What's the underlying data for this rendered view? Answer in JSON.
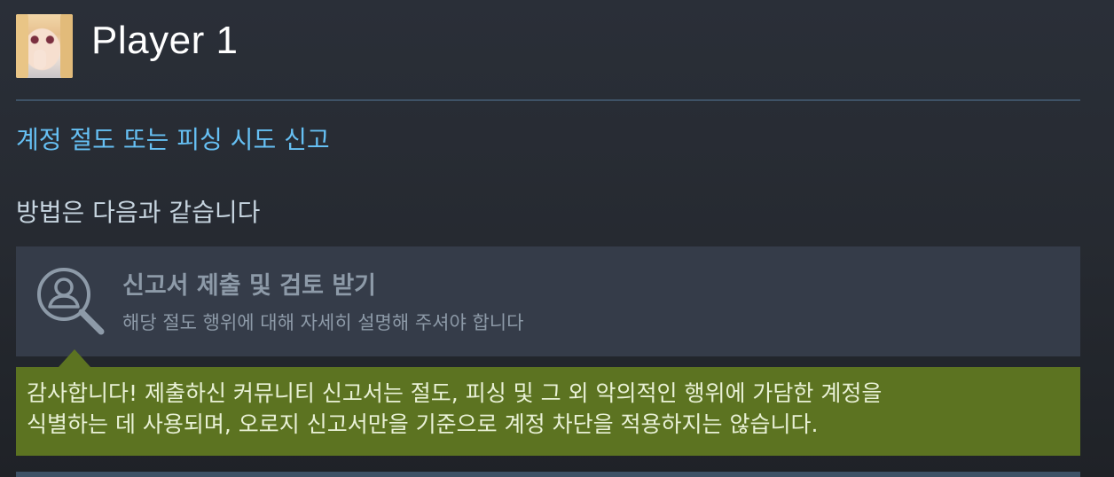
{
  "profile": {
    "name": "Player 1",
    "avatar_icon": "anime-avatar-image"
  },
  "report": {
    "link_label": "계정 절도 또는 피싱 시도 신고",
    "subheading": "방법은 다음과 같습니다"
  },
  "step": {
    "icon": "magnifier-user-icon",
    "title": "신고서 제출 및 검토 받기",
    "description": "해당 절도 행위에 대해 자세히 설명해 주셔야 합니다"
  },
  "confirmation": {
    "line1": "감사합니다! 제출하신 커뮤니티 신고서는 절도, 피싱 및 그 외 악의적인 행위에 가담한 계정을",
    "line2": "식별하는 데 사용되며, 오로지 신고서만을 기준으로 계정 차단을 적용하지는 않습니다."
  },
  "colors": {
    "link": "#66c0f4",
    "confirmation_bg": "#5c7321",
    "step_bg": "#353c49",
    "divider": "#3e5266"
  }
}
